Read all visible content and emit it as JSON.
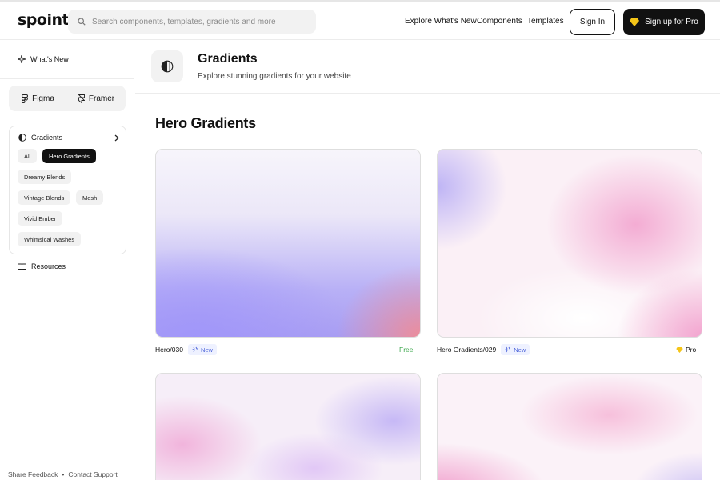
{
  "header": {
    "logo": "spoint",
    "search_placeholder": "Search components, templates, gradients and more",
    "nav": [
      "Explore What's New",
      "Components",
      "Templates"
    ],
    "signin_label": "Sign In",
    "pro_label": "Sign up for Pro"
  },
  "sidebar": {
    "whats_new": "What's New",
    "tools": [
      "Figma",
      "Framer"
    ],
    "category": "Gradients",
    "chips": [
      "All",
      "Hero Gradients",
      "Dreamy Blends",
      "Vintage Blends",
      "Mesh",
      "Vivid Ember",
      "Whimsical Washes"
    ],
    "active_chip": "Hero Gradients",
    "resources": "Resources",
    "footer_links": [
      "Share Feedback",
      "Contact Support"
    ]
  },
  "page": {
    "title": "Gradients",
    "subtitle": "Explore stunning gradients for your website",
    "section_title": "Hero Gradients"
  },
  "cards": [
    {
      "name": "Hero/030",
      "badge": "New",
      "tier": "Free"
    },
    {
      "name": "Hero Gradients/029",
      "badge": "New",
      "tier": "Pro"
    },
    {
      "name": "",
      "badge": "",
      "tier": ""
    },
    {
      "name": "",
      "badge": "",
      "tier": ""
    }
  ],
  "colors": {
    "accent": "#111111",
    "free": "#3aa64b",
    "new_badge": "#4b63d9",
    "pro_gem": "#f5c518"
  }
}
